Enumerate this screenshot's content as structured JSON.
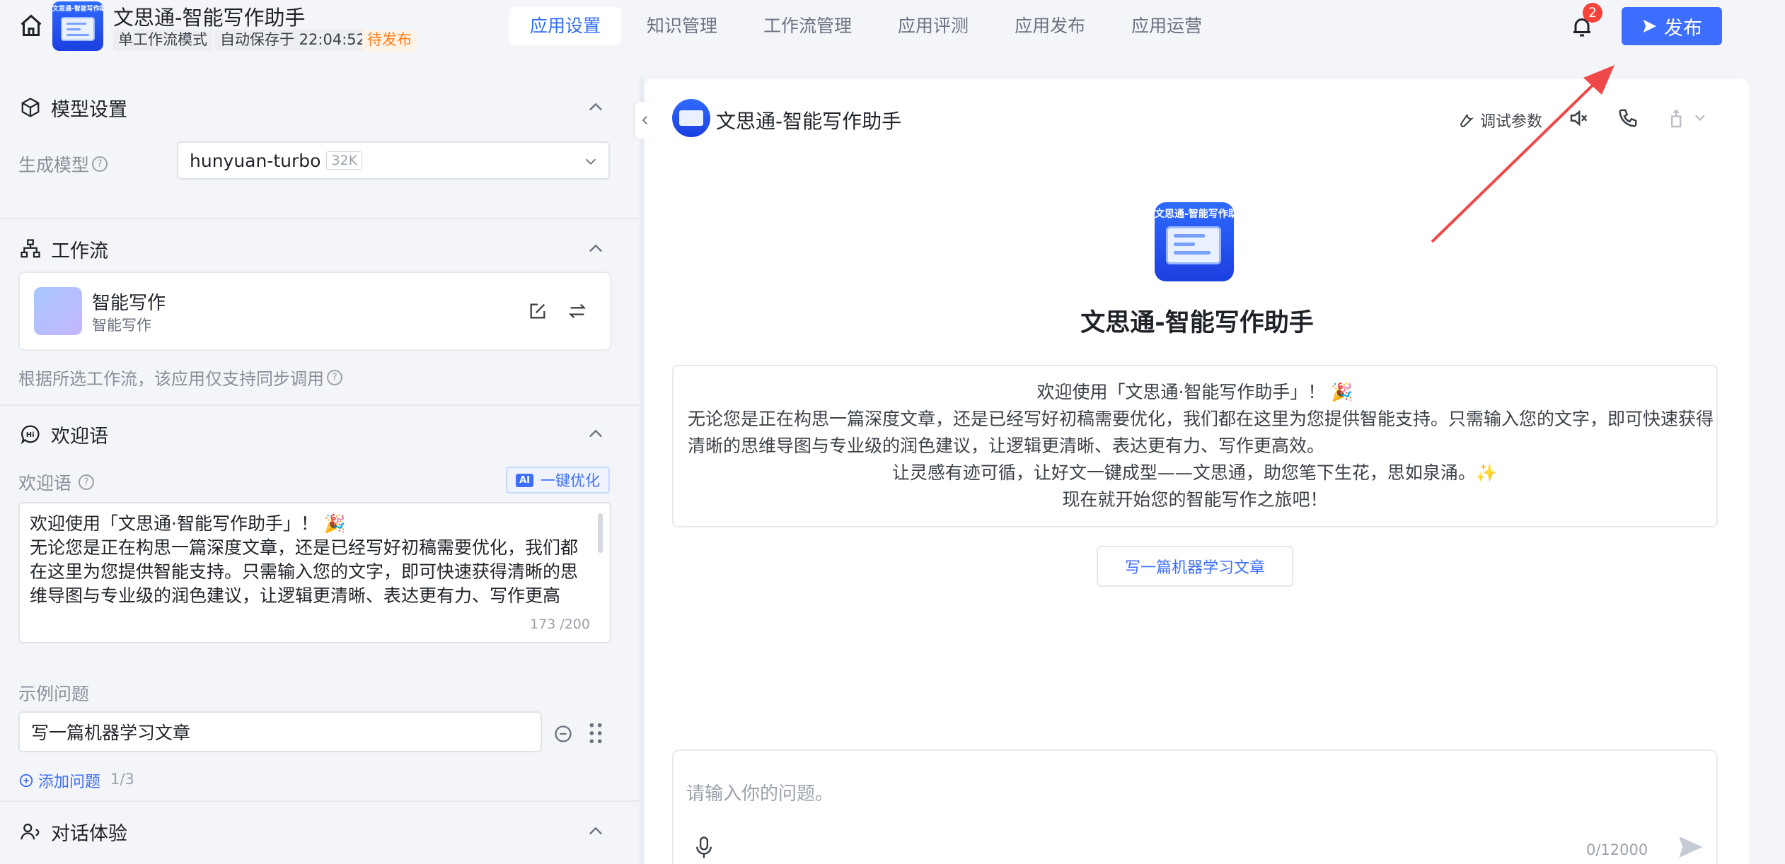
{
  "header": {
    "app_title": "文思通-智能写作助手",
    "logo_caption": "文思通-智能写作助",
    "mode_tag": "单工作流模式",
    "autosave": "自动保存于 22:04:52",
    "status": "待发布",
    "tabs": [
      "应用设置",
      "知识管理",
      "工作流管理",
      "应用评测",
      "应用发布",
      "应用运营"
    ],
    "active_tab": "应用设置",
    "notification_count": "2",
    "publish_label": "发布"
  },
  "model_section": {
    "title": "模型设置",
    "label": "生成模型",
    "model": "hunyuan-turbo",
    "context": "32K"
  },
  "workflow_section": {
    "title": "工作流",
    "name": "智能写作",
    "subtitle": "智能写作",
    "note": "根据所选工作流，该应用仅支持同步调用"
  },
  "welcome_section": {
    "title": "欢迎语",
    "label": "欢迎语",
    "ai_button": "一键优化",
    "ai_tag": "AI",
    "text": "欢迎使用「文思通·智能写作助手」！ 🎉\n无论您是正在构思一篇深度文章，还是已经写好初稿需要优化，我们都在这里为您提供智能支持。只需输入您的文字，即可快速获得清晰的思维导图与专业级的润色建议，让逻辑更清晰、表达更有力、写作更高效。",
    "count": "173 /200",
    "example_label": "示例问题",
    "example_question": "写一篇机器学习文章",
    "add_question": "添加问题",
    "question_count": "1/3"
  },
  "dialog_section": {
    "title": "对话体验"
  },
  "preview": {
    "title": "文思通-智能写作助手",
    "debug_label": "调试参数",
    "center_caption": "文思通-智能写作助",
    "center_name": "文思通-智能写作助手",
    "message_lines": [
      "欢迎使用「文思通·智能写作助手」！ 🎉",
      "无论您是正在构思一篇深度文章，还是已经写好初稿需要优化，我们都在这里为您提供智能支持。只需输入您的文字，即可快速获得",
      "清晰的思维导图与专业级的润色建议，让逻辑更清晰、表达更有力、写作更高效。",
      "让灵感有迹可循，让好文一键成型——文思通，助您笔下生花，思如泉涌。✨",
      "现在就开始您的智能写作之旅吧！"
    ],
    "suggestion": "写一篇机器学习文章",
    "input_placeholder": "请输入你的问题。",
    "input_count": "0/12000"
  },
  "colors": {
    "accent": "#3e6eff",
    "pending": "#ff7d1a",
    "badge": "#f5423a",
    "annotation_arrow": "#f04848"
  }
}
